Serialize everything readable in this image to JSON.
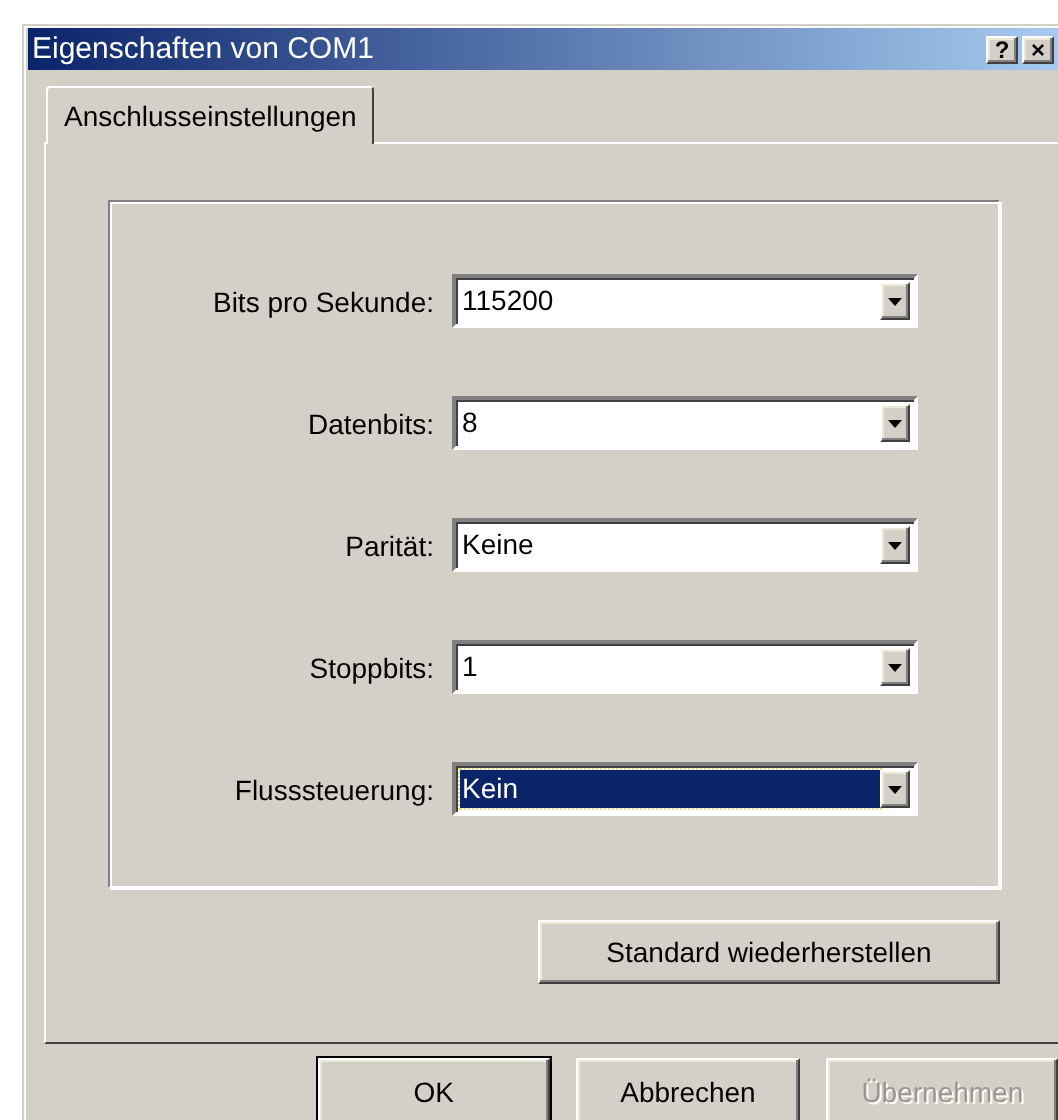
{
  "window": {
    "title": "Eigenschaften von COM1",
    "title_buttons": [
      "?",
      "×"
    ]
  },
  "tabs": [
    {
      "label": "Anschlusseinstellungen",
      "selected": true
    }
  ],
  "settings": [
    {
      "label": "Bits pro Sekunde:",
      "value": "115200",
      "focused": false
    },
    {
      "label": "Datenbits:",
      "value": "8",
      "focused": false
    },
    {
      "label": "Parität:",
      "value": "Keine",
      "focused": false
    },
    {
      "label": "Stoppbits:",
      "value": "1",
      "focused": false
    },
    {
      "label": "Flusssteuerung:",
      "value": "Kein",
      "focused": true
    }
  ],
  "restore_button": {
    "label": "Standard wiederherstellen",
    "disabled": false
  },
  "buttons": [
    {
      "label": "OK",
      "default": true,
      "disabled": false
    },
    {
      "label": "Abbrechen",
      "default": false,
      "disabled": false
    },
    {
      "label": "Übernehmen",
      "default": false,
      "disabled": true
    }
  ]
}
